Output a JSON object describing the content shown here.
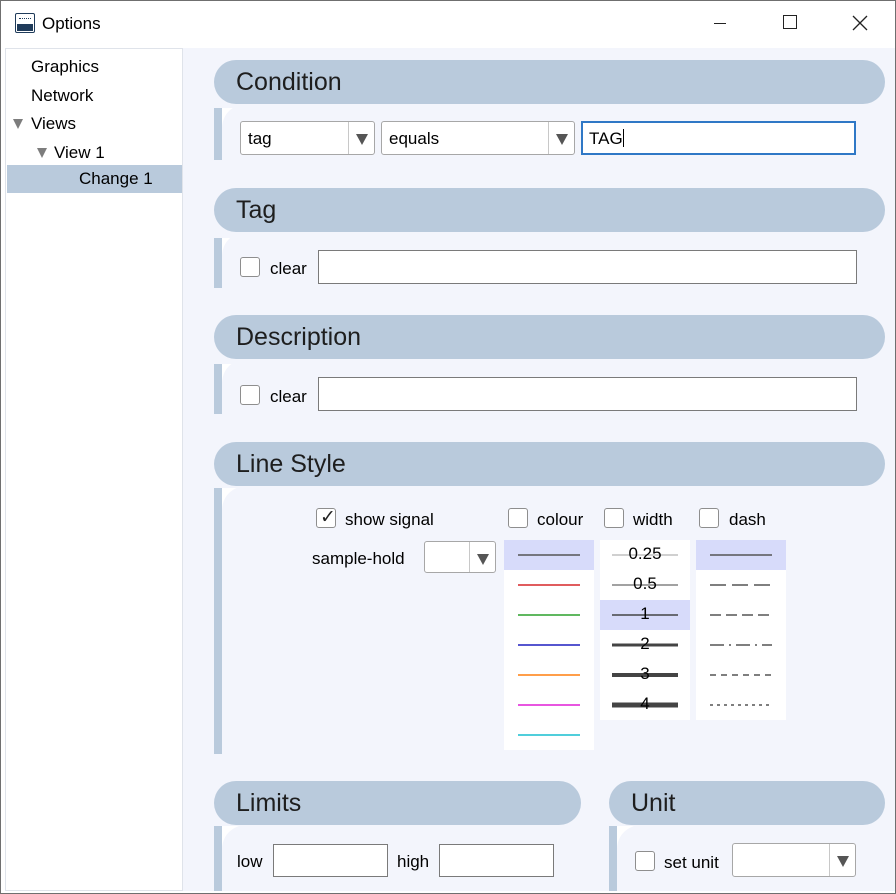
{
  "window": {
    "title": "Options",
    "icon": "app-logo-icon",
    "controls": [
      "minimize-icon",
      "maximize-icon",
      "close-icon"
    ]
  },
  "sidebar": {
    "items": [
      {
        "label": "Graphics",
        "level": 0,
        "expanded": null,
        "selected": false
      },
      {
        "label": "Network",
        "level": 0,
        "expanded": null,
        "selected": false
      },
      {
        "label": "Views",
        "level": 0,
        "expanded": true,
        "selected": false
      },
      {
        "label": "View 1",
        "level": 1,
        "expanded": true,
        "selected": false
      },
      {
        "label": "Change 1",
        "level": 2,
        "expanded": null,
        "selected": true
      }
    ]
  },
  "condition": {
    "title": "Condition",
    "field": {
      "value": "tag"
    },
    "operator": {
      "value": "equals"
    },
    "value": "TAG"
  },
  "tag": {
    "title": "Tag",
    "clear_label": "clear",
    "clear_checked": false,
    "value": ""
  },
  "description": {
    "title": "Description",
    "clear_label": "clear",
    "clear_checked": false,
    "value": ""
  },
  "line_style": {
    "title": "Line Style",
    "show_signal_label": "show signal",
    "show_signal_checked": true,
    "sample_hold_label": "sample-hold",
    "sample_hold_value": "",
    "colour_label": "colour",
    "colour_checked": false,
    "width_label": "width",
    "width_checked": false,
    "dash_label": "dash",
    "dash_checked": false,
    "colours": [
      "#555555",
      "#d62728",
      "#2ca02c",
      "#1f1fbf",
      "#ff7f0e",
      "#e01fd6",
      "#17becf"
    ],
    "colour_selected": 0,
    "widths": [
      "0.25",
      "0.5",
      "1",
      "2",
      "3",
      "4"
    ],
    "width_selected": 2,
    "dashes": [
      "solid",
      "long-dash",
      "dash",
      "dash-dot",
      "short-dash",
      "dot"
    ],
    "dash_selected": 0
  },
  "limits": {
    "title": "Limits",
    "low_label": "low",
    "low_value": "",
    "high_label": "high",
    "high_value": ""
  },
  "unit": {
    "title": "Unit",
    "set_unit_label": "set unit",
    "set_unit_checked": false,
    "unit_value": ""
  },
  "colors": {
    "header": "#b9cadc",
    "panel": "#f3f5fc",
    "selection": "#d7dbfa",
    "focus": "#2f78c6"
  }
}
